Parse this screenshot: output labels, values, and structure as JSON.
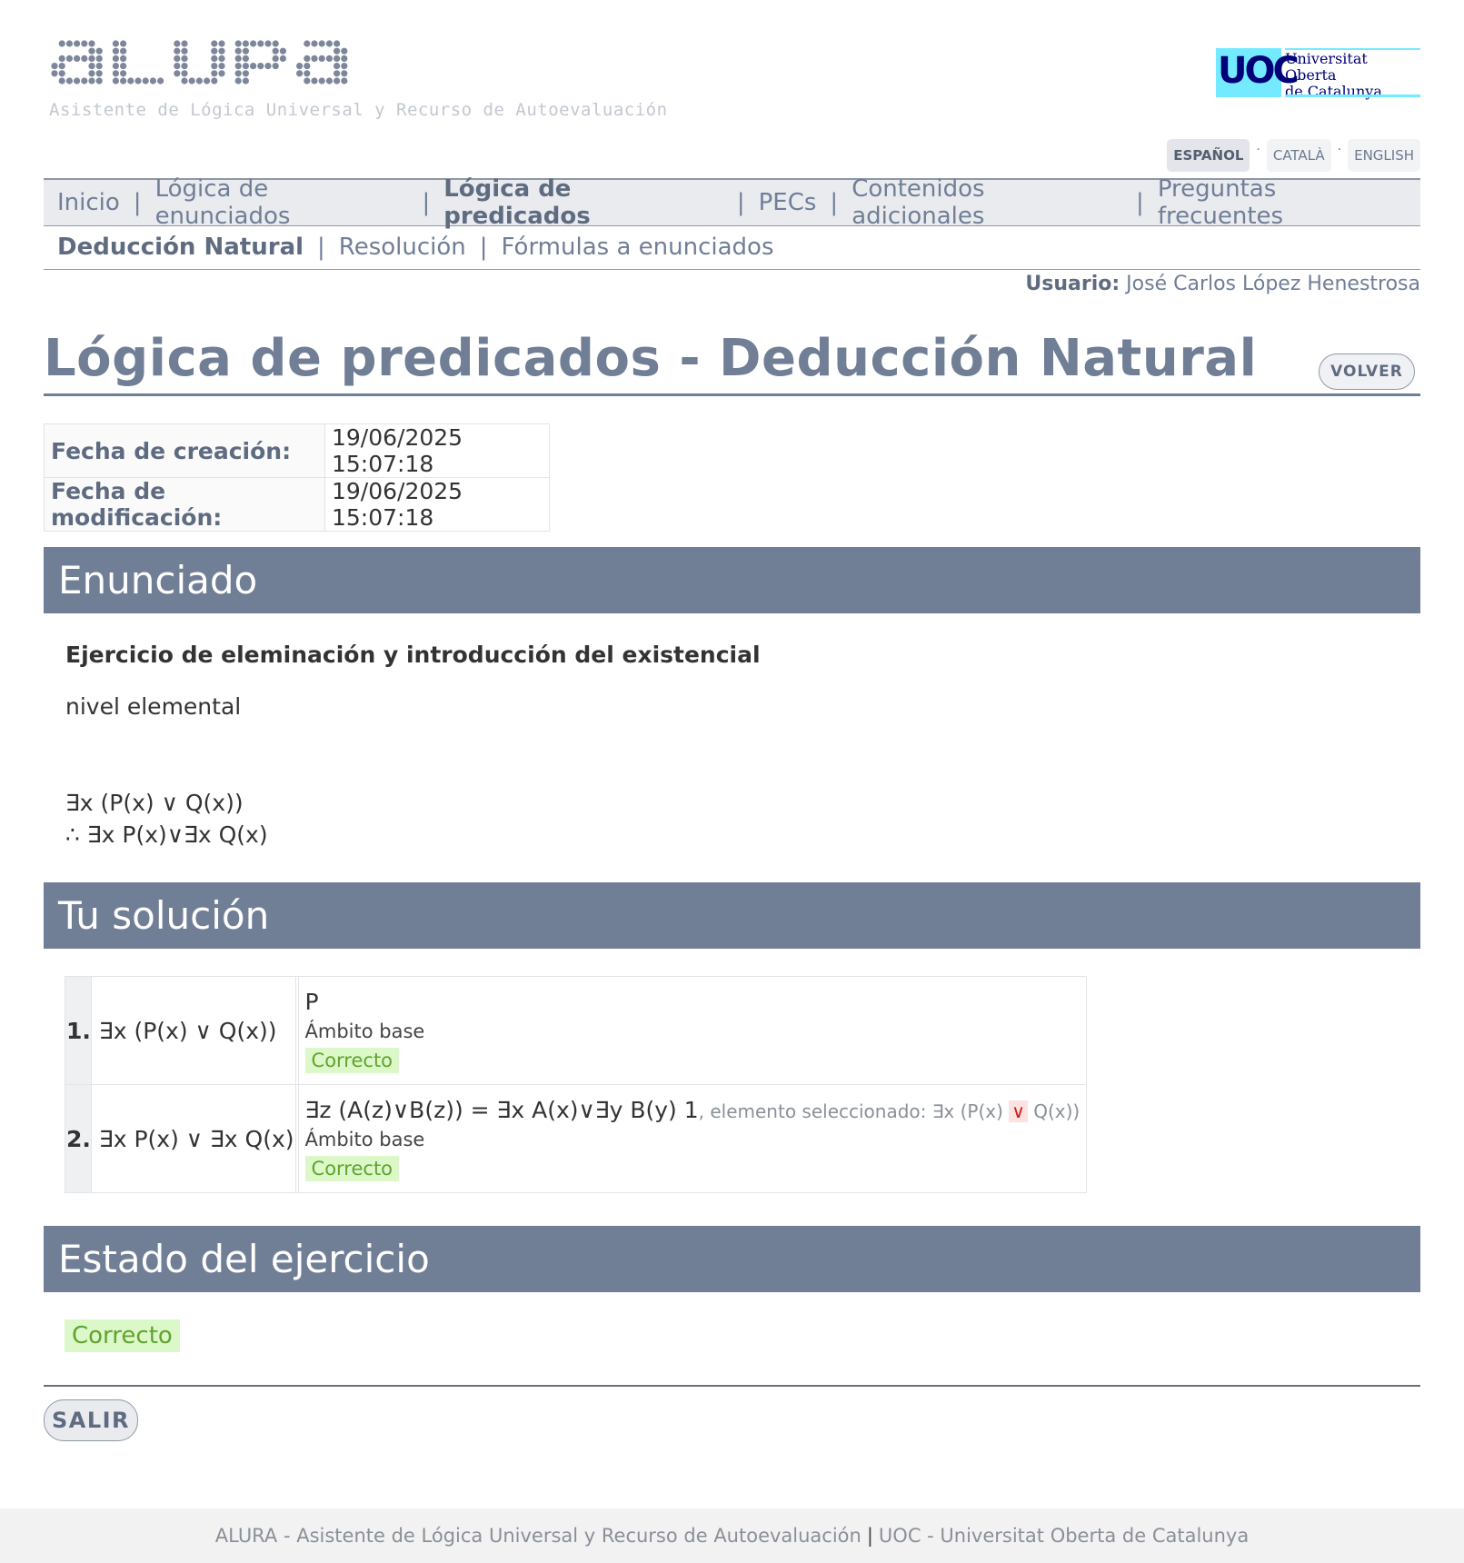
{
  "header": {
    "logo_text": "ALURA",
    "tagline": "Asistente de Lógica Universal y Recurso de Autoevaluación",
    "uoc_letters": "UOC",
    "uoc_name_line1": "Universitat Oberta",
    "uoc_name_line2": "de Catalunya"
  },
  "languages": [
    {
      "label": "ESPAÑOL",
      "active": true
    },
    {
      "label": "CATALÀ",
      "active": false
    },
    {
      "label": "ENGLISH",
      "active": false
    }
  ],
  "nav_main": [
    "Inicio",
    "Lógica de enunciados",
    "Lógica de predicados",
    "PECs",
    "Contenidos adicionales",
    "Preguntas frecuentes"
  ],
  "nav_sub": [
    "Deducción Natural",
    "Resolución",
    "Fórmulas a enunciados"
  ],
  "user": {
    "label": "Usuario:",
    "name": "José Carlos López Henestrosa"
  },
  "page": {
    "title": "Lógica de predicados - Deducción Natural",
    "back_button": "VOLVER"
  },
  "dates": {
    "created_label": "Fecha de creación:",
    "created_value": "19/06/2025 15:07:18",
    "modified_label": "Fecha de modificación:",
    "modified_value": "19/06/2025 15:07:18"
  },
  "sections": {
    "statement": "Enunciado",
    "solution": "Tu solución",
    "status": "Estado del ejercicio"
  },
  "statement": {
    "title": "Ejercicio de eleminación y introducción del existencial",
    "level": "nivel elemental",
    "premise": "∃x (P(x) ∨ Q(x))",
    "conclusion": "∴ ∃x P(x)∨∃x Q(x)"
  },
  "solution_rows": [
    {
      "number": "1.",
      "formula": "∃x (P(x) ∨ Q(x))",
      "rule": "P",
      "rule_extra_prefix": "",
      "rule_extra_highlight": "",
      "rule_extra_suffix": "",
      "scope": "Ámbito base",
      "result": "Correcto"
    },
    {
      "number": "2.",
      "formula": "∃x P(x) ∨ ∃x Q(x)",
      "rule": "∃z (A(z)∨B(z)) = ∃x A(x)∨∃y B(y) 1",
      "rule_extra_prefix": ", elemento seleccionado: ∃x (P(x) ",
      "rule_extra_highlight": "∨",
      "rule_extra_suffix": " Q(x))",
      "scope": "Ámbito base",
      "result": "Correcto"
    }
  ],
  "status": {
    "result": "Correcto"
  },
  "exit_button": "SALIR",
  "footer": {
    "left": "ALURA - Asistente de Lógica Universal y Recurso de Autoevaluación",
    "separator": "|",
    "right": "UOC - Universitat Oberta de Catalunya"
  },
  "colors": {
    "section_header": "#717f96",
    "nav_text": "#707e96",
    "success_bg": "#dcf7c8",
    "success_text": "#5fa52e",
    "uoc_cyan": "#73eaff",
    "uoc_navy": "#000078"
  }
}
